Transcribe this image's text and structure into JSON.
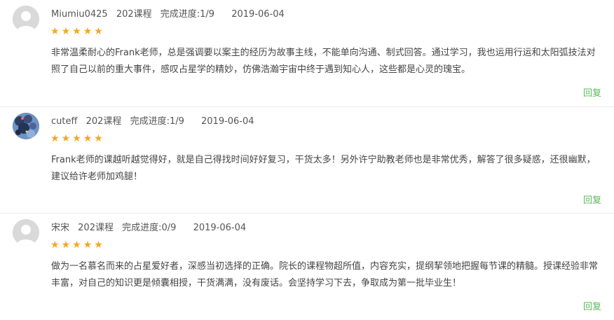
{
  "reviews": [
    {
      "username": "Miumiu0425",
      "courses": "202课程",
      "progress": "完成进度:1/9",
      "date": "2019-06-04",
      "rating": 5,
      "content": "非常温柔耐心的Frank老师，总是强调要以案主的经历为故事主线，不能单向沟通、制式回答。通过学习，我也运用行运和太阳弧技法对照了自己以前的重大事件，感叹占星学的精妙，仿佛浩瀚宇宙中终于遇到知心人，这些都是心灵的瑰宝。",
      "reply_label": "回复"
    },
    {
      "username": "cuteff",
      "courses": "202课程",
      "progress": "完成进度:1/9",
      "date": "2019-06-04",
      "rating": 5,
      "content": "Frank老师的课越听越觉得好，就是自己得找时间好好复习，干货太多！另外许宁助教老师也是非常优秀，解答了很多疑惑，还很幽默，建议给许老师加鸡腿！",
      "reply_label": "回复"
    },
    {
      "username": "宋宋",
      "courses": "202课程",
      "progress": "完成进度:0/9",
      "date": "2019-06-04",
      "rating": 5,
      "content": "做为一名慕名而来的占星爱好者，深感当初选择的正确。院长的课程物超所值，内容充实，提纲挈领地把握每节课的精髓。授课经验非常丰富，对自己的知识更是倾囊相授，干货满满，没有废话。会坚持学习下去，争取成为第一批毕业生！",
      "reply_label": "回复"
    }
  ],
  "colors": {
    "star": "#f5a623",
    "reply": "#5cb85c",
    "text": "#444444",
    "meta": "#555555"
  },
  "icons": {
    "avatar_default": "default-user-avatar-icon",
    "avatar_photo": "user-photo-avatar",
    "star": "star-icon"
  }
}
